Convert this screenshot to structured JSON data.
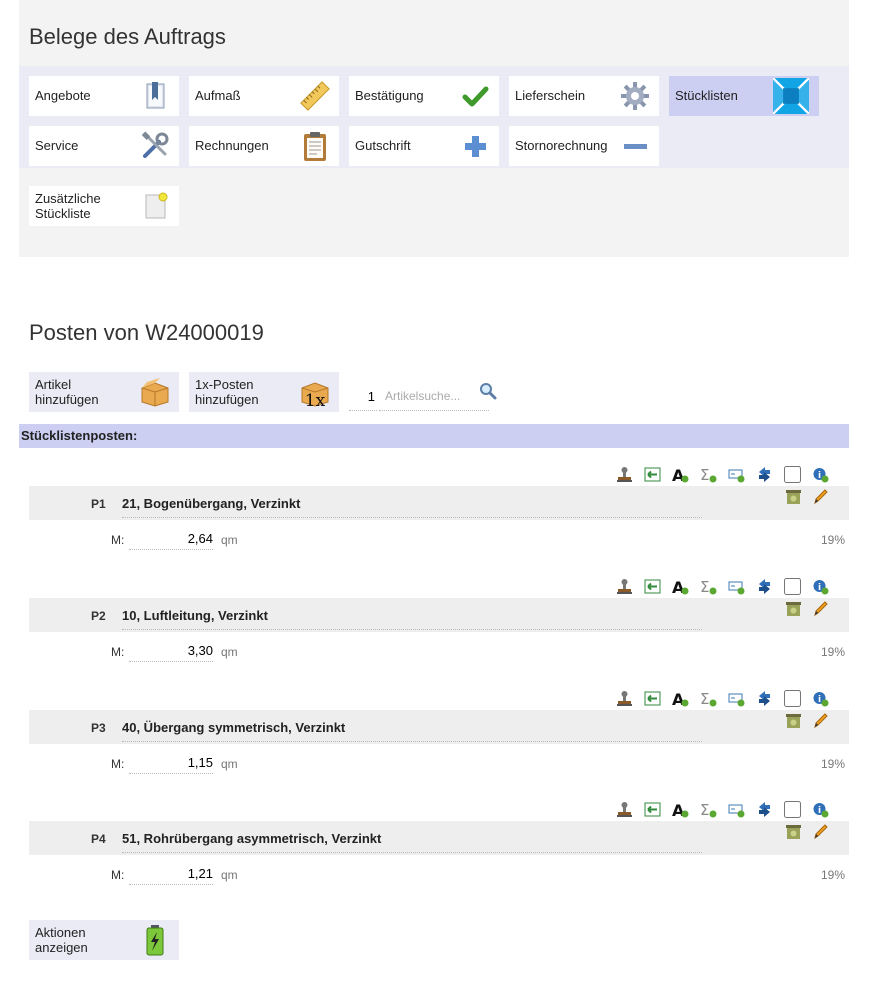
{
  "header": {
    "title": "Belege des Auftrags"
  },
  "documents": [
    {
      "label": "Angebote",
      "icon": "bookmark-icon"
    },
    {
      "label": "Aufmaß",
      "icon": "ruler-icon"
    },
    {
      "label": "Bestätigung",
      "icon": "checkmark-icon"
    },
    {
      "label": "Lieferschein",
      "icon": "gear-icon"
    },
    {
      "label": "Stücklisten",
      "icon": "stuecklisten-icon",
      "active": true
    },
    {
      "label": "Service",
      "icon": "tools-icon"
    },
    {
      "label": "Rechnungen",
      "icon": "clipboard-icon"
    },
    {
      "label": "Gutschrift",
      "icon": "plus-icon"
    },
    {
      "label": "Stornorechnung",
      "icon": "minus-icon"
    },
    {
      "label": "Zusätzliche\nStückliste",
      "icon": "new-document-icon"
    }
  ],
  "positions": {
    "title": "Posten von W24000019",
    "add_article_label": "Artikel\nhinzufügen",
    "add_once_label": "1x-Posten\nhinzufügen",
    "once_icon_text": "1x",
    "quantity": "1",
    "search_placeholder": "Artikelsuche..."
  },
  "list": {
    "header": "Stücklistenposten:",
    "items": [
      {
        "pos": "P1",
        "title": "21, Bogenübergang, Verzinkt",
        "m_label": "M:",
        "value": "2,64",
        "unit": "qm",
        "vat": "19%"
      },
      {
        "pos": "P2",
        "title": "10, Luftleitung, Verzinkt",
        "m_label": "M:",
        "value": "3,30",
        "unit": "qm",
        "vat": "19%"
      },
      {
        "pos": "P3",
        "title": "40, Übergang symmetrisch, Verzinkt",
        "m_label": "M:",
        "value": "1,15",
        "unit": "qm",
        "vat": "19%"
      },
      {
        "pos": "P4",
        "title": "51, Rohrübergang asymmetrisch, Verzinkt",
        "m_label": "M:",
        "value": "1,21",
        "unit": "qm",
        "vat": "19%"
      }
    ]
  },
  "footer": {
    "actions_label": "Aktionen\nanzeigen"
  },
  "colors": {
    "active_tile": "#cccef2",
    "band": "#ebebf5",
    "header_bar": "#cccef2",
    "accent_green": "#5aa832",
    "accent_blue": "#1e8fd8"
  }
}
